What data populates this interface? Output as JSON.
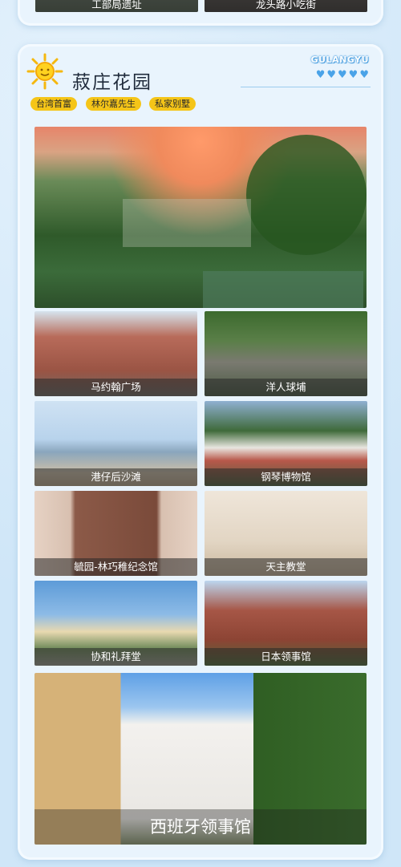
{
  "top_captions": {
    "left": "工部局遗址",
    "right": "龙头路小吃街"
  },
  "section": {
    "title": "菽庄花园",
    "brand": "GULANGYU",
    "hearts": "♥♥♥♥♥",
    "tags": [
      "台湾首富",
      "林尔嘉先生",
      "私家别墅"
    ]
  },
  "photos": [
    {
      "caption": "马约翰广场"
    },
    {
      "caption": "洋人球埔"
    },
    {
      "caption": "港仔后沙滩"
    },
    {
      "caption": "钢琴博物馆"
    },
    {
      "caption": "毓园-林巧稚纪念馆"
    },
    {
      "caption": "天主教堂"
    },
    {
      "caption": "协和礼拜堂"
    },
    {
      "caption": "日本领事馆"
    },
    {
      "caption": "西班牙领事馆"
    }
  ]
}
